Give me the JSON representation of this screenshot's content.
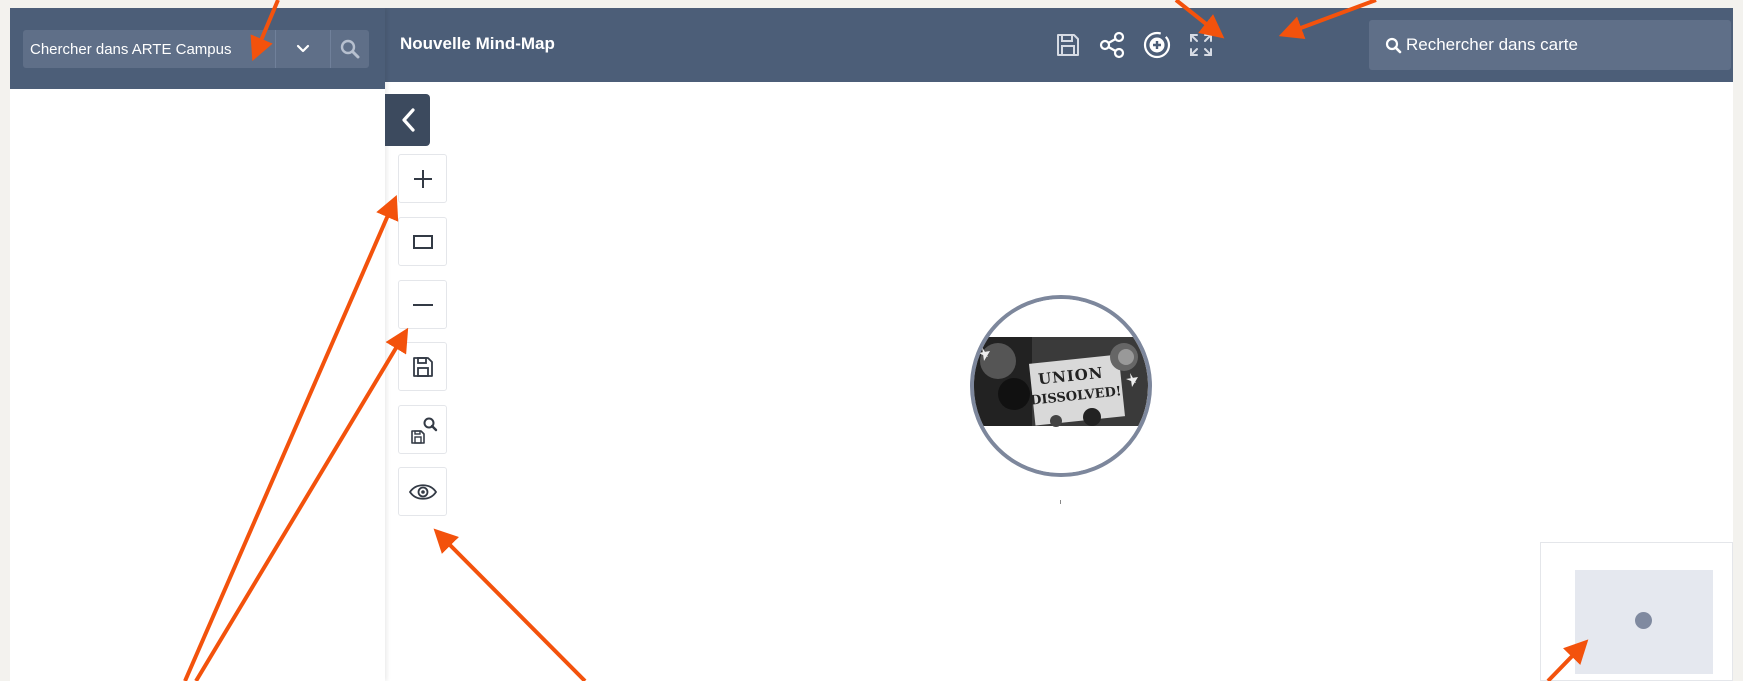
{
  "sidebar": {
    "search_text": "Chercher dans ARTE Campus",
    "dropdown_icon": "chevron-down-icon",
    "search_icon": "search-icon"
  },
  "topbar": {
    "title": "Nouvelle Mind-Map",
    "icons": [
      "save-icon",
      "share-icon",
      "add-circle-icon",
      "fullscreen-icon"
    ],
    "search_text": "Rechercher dans carte"
  },
  "tools": [
    "zoom-in-icon",
    "fit-screen-icon",
    "zoom-out-icon",
    "save-icon",
    "save-search-icon",
    "preview-eye-icon"
  ],
  "central_node": {
    "image_text_line1": "UNION",
    "image_text_line2": "DISSOLVED!"
  },
  "colors": {
    "header": "#4c5e78",
    "header_input": "#5f6f88",
    "node_border": "#7d879c",
    "annotation": "#f3520c"
  }
}
